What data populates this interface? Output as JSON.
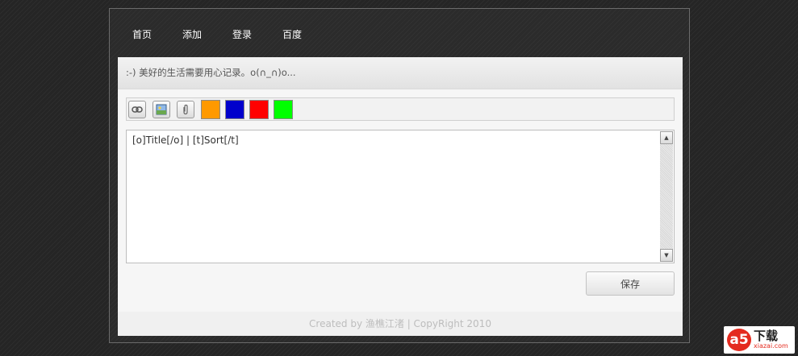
{
  "nav": {
    "items": [
      {
        "label": "首页"
      },
      {
        "label": "添加"
      },
      {
        "label": "登录"
      },
      {
        "label": "百度"
      }
    ]
  },
  "tagline": ":-) 美好的生活需要用心记录。o(∩_∩)o...",
  "toolbar": {
    "tools": [
      {
        "icon": "link-icon"
      },
      {
        "icon": "image-icon"
      },
      {
        "icon": "attachment-icon"
      }
    ],
    "colors": [
      "#ff9900",
      "#0000cc",
      "#ff0000",
      "#00ff00"
    ]
  },
  "editor": {
    "value": "[o]Title[/o] | [t]Sort[/t]"
  },
  "save_label": "保存",
  "footer": {
    "text": "Created by 渔樵江渚 | CopyRight 2010"
  },
  "watermark": {
    "logo": "a5",
    "main": "下载",
    "sub": "xiazai.com"
  }
}
